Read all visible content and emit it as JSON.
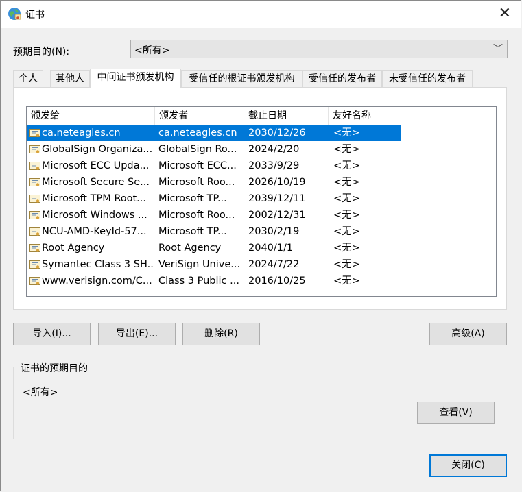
{
  "window": {
    "title": "证书"
  },
  "purpose": {
    "label": "预期目的(N):",
    "value": "<所有>"
  },
  "tabs": [
    "个人",
    "其他人",
    "中间证书颁发机构",
    "受信任的根证书颁发机构",
    "受信任的发布者",
    "未受信任的发布者"
  ],
  "columns": [
    "颁发给",
    "颁发者",
    "截止日期",
    "友好名称"
  ],
  "rows": [
    {
      "issued_to": "ca.neteagles.cn",
      "issued_by": "ca.neteagles.cn",
      "expires": "2030/12/26",
      "friendly": "<无>",
      "selected": true
    },
    {
      "issued_to": "GlobalSign Organiza...",
      "issued_by": "GlobalSign Ro...",
      "expires": "2024/2/20",
      "friendly": "<无>"
    },
    {
      "issued_to": "Microsoft ECC Upda...",
      "issued_by": "Microsoft ECC...",
      "expires": "2033/9/29",
      "friendly": "<无>"
    },
    {
      "issued_to": "Microsoft Secure Se...",
      "issued_by": "Microsoft Roo...",
      "expires": "2026/10/19",
      "friendly": "<无>"
    },
    {
      "issued_to": "Microsoft TPM Root...",
      "issued_by": "Microsoft TP...",
      "expires": "2039/12/11",
      "friendly": "<无>"
    },
    {
      "issued_to": "Microsoft Windows ...",
      "issued_by": "Microsoft Roo...",
      "expires": "2002/12/31",
      "friendly": "<无>"
    },
    {
      "issued_to": "NCU-AMD-KeyId-57...",
      "issued_by": "Microsoft TP...",
      "expires": "2030/2/19",
      "friendly": "<无>"
    },
    {
      "issued_to": "Root Agency",
      "issued_by": "Root Agency",
      "expires": "2040/1/1",
      "friendly": "<无>"
    },
    {
      "issued_to": "Symantec Class 3 SH...",
      "issued_by": "VeriSign Unive...",
      "expires": "2024/7/22",
      "friendly": "<无>"
    },
    {
      "issued_to": "www.verisign.com/C...",
      "issued_by": "Class 3 Public ...",
      "expires": "2016/10/25",
      "friendly": "<无>"
    }
  ],
  "buttons": {
    "import": "导入(I)...",
    "export": "导出(E)...",
    "remove": "删除(R)",
    "advanced": "高级(A)",
    "view": "查看(V)",
    "close": "关闭(C)"
  },
  "purpose_group": {
    "title": "证书的预期目的",
    "value": "<所有>"
  },
  "colors": {
    "selection": "#0078d7"
  }
}
